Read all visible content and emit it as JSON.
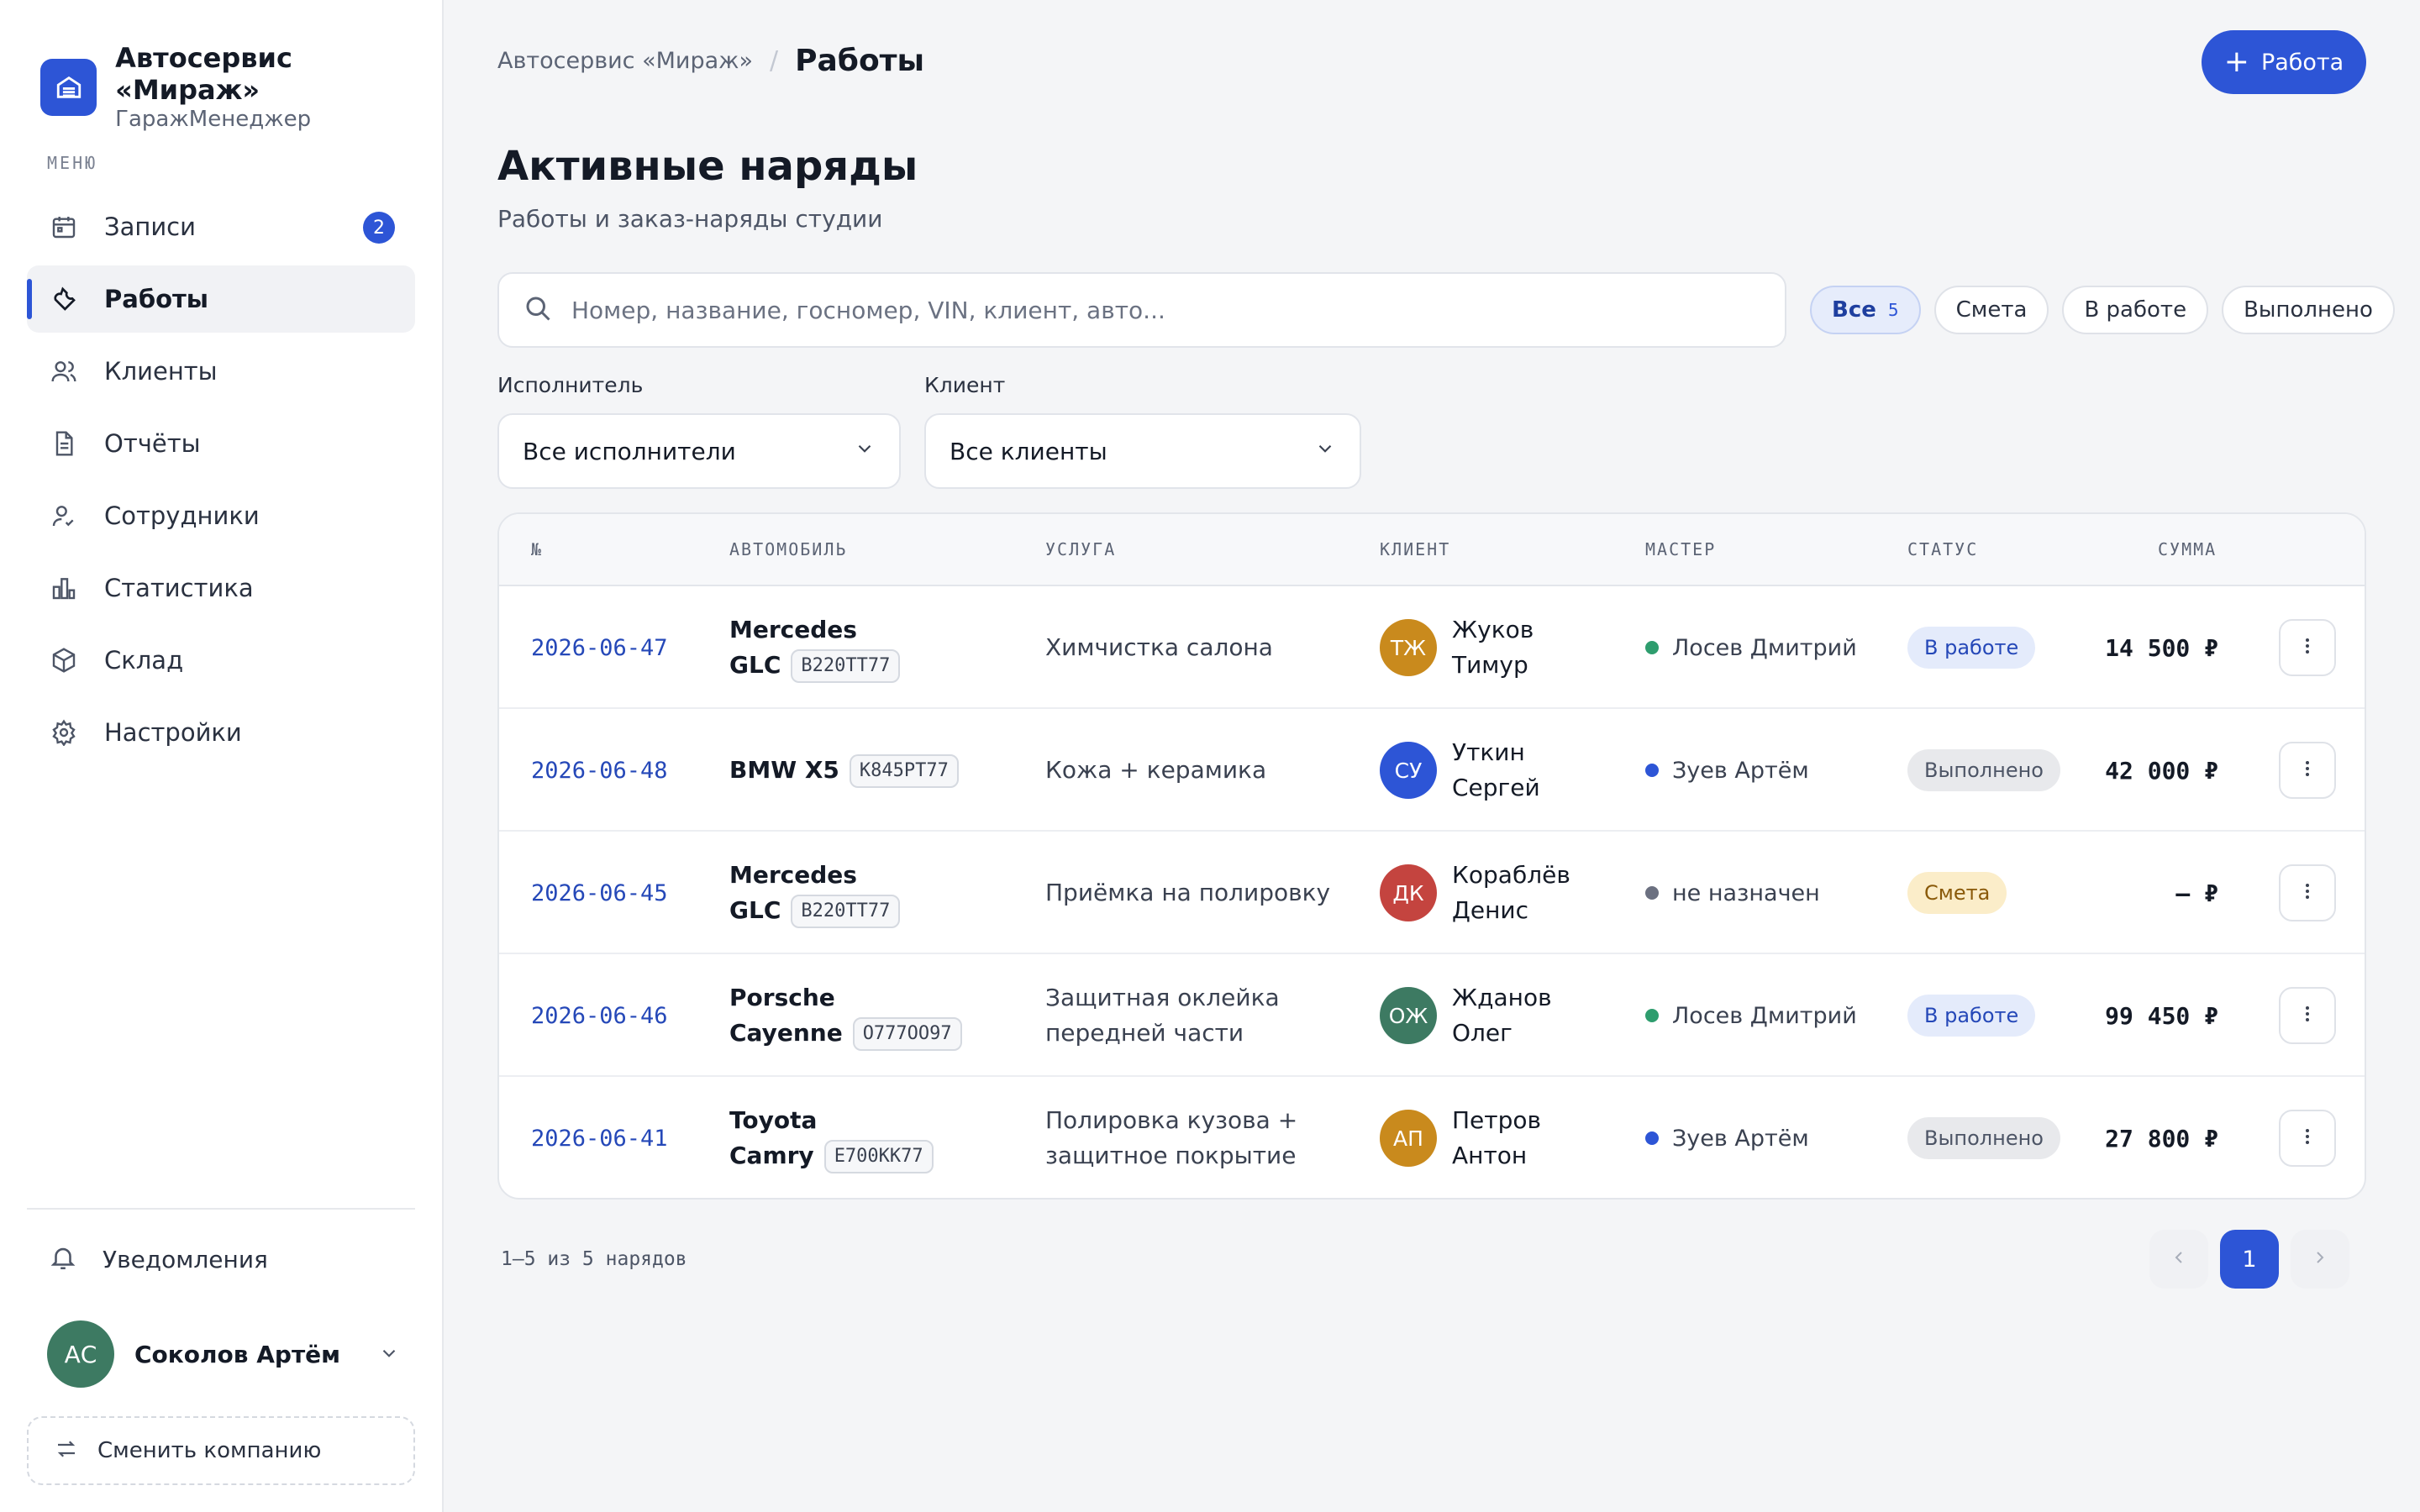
{
  "brand": {
    "name": "Автосервис «Мираж»",
    "subtitle": "ГаражМенеджер"
  },
  "sidebar": {
    "menu_label": "МЕНЮ",
    "items": [
      {
        "label": "Записи",
        "icon": "calendar-icon",
        "badge": "2"
      },
      {
        "label": "Работы",
        "icon": "wrench-icon",
        "active": true
      },
      {
        "label": "Клиенты",
        "icon": "users-icon"
      },
      {
        "label": "Отчёты",
        "icon": "document-icon"
      },
      {
        "label": "Сотрудники",
        "icon": "user-check-icon"
      },
      {
        "label": "Статистика",
        "icon": "bar-chart-icon"
      },
      {
        "label": "Склад",
        "icon": "box-icon"
      },
      {
        "label": "Настройки",
        "icon": "gear-icon"
      }
    ],
    "notifications_label": "Уведомления",
    "user": {
      "initials": "АС",
      "name": "Соколов Артём"
    },
    "switch_company_label": "Сменить компанию"
  },
  "header": {
    "breadcrumb_parent": "Автосервис «Мираж»",
    "breadcrumb_sep": "/",
    "breadcrumb_current": "Работы",
    "add_button_label": "Работа"
  },
  "page": {
    "title": "Активные наряды",
    "subtitle": "Работы и заказ-наряды студии"
  },
  "search": {
    "placeholder": "Номер, название, госномер, VIN, клиент, авто..."
  },
  "status_filters": [
    {
      "label": "Все",
      "count": "5",
      "active": true
    },
    {
      "label": "Смета"
    },
    {
      "label": "В работе"
    },
    {
      "label": "Выполнено"
    }
  ],
  "filters": {
    "executor_label": "Исполнитель",
    "executor_value": "Все исполнители",
    "client_label": "Клиент",
    "client_value": "Все клиенты"
  },
  "table": {
    "columns": [
      "№",
      "АВТОМОБИЛЬ",
      "УСЛУГА",
      "КЛИЕНТ",
      "МАСТЕР",
      "СТАТУС",
      "СУММА"
    ],
    "rows": [
      {
        "no": "2026-06-47",
        "car_line1": "Mercedes",
        "car_line2": "GLC",
        "plate": "В220ТТ77",
        "service_line1": "Химчистка салона",
        "service_line2": "",
        "client_initials": "ТЖ",
        "client_line1": "Жуков",
        "client_line2": "Тимур",
        "client_color": "#c98a1d",
        "master": "Лосев Дмитрий",
        "master_dot": "#2e9d6e",
        "status": "В работе",
        "status_kind": "work",
        "amount": "14 500 ₽"
      },
      {
        "no": "2026-06-48",
        "car_line1": "BMW X5",
        "car_line2": "",
        "plate": "К845РТ77",
        "service_line1": "Кожа + керамика",
        "service_line2": "",
        "client_initials": "СУ",
        "client_line1": "Уткин",
        "client_line2": "Сергей",
        "client_color": "#2d55d6",
        "master": "Зуев Артём",
        "master_dot": "#2d55d6",
        "status": "Выполнено",
        "status_kind": "done",
        "amount": "42 000 ₽"
      },
      {
        "no": "2026-06-45",
        "car_line1": "Mercedes",
        "car_line2": "GLC",
        "plate": "В220ТТ77",
        "service_line1": "Приёмка на полировку",
        "service_line2": "",
        "client_initials": "ДК",
        "client_line1": "Кораблёв",
        "client_line2": "Денис",
        "client_color": "#c4443f",
        "master": "не назначен",
        "master_dot": "#6b7080",
        "status": "Смета",
        "status_kind": "estimate",
        "amount": "— ₽"
      },
      {
        "no": "2026-06-46",
        "car_line1": "Porsche",
        "car_line2": "Cayenne",
        "plate": "О777ОО97",
        "service_line1": "Защитная оклейка",
        "service_line2": "передней части",
        "client_initials": "ОЖ",
        "client_line1": "Жданов",
        "client_line2": "Олег",
        "client_color": "#3d7a62",
        "master": "Лосев Дмитрий",
        "master_dot": "#2e9d6e",
        "status": "В работе",
        "status_kind": "work",
        "amount": "99 450 ₽"
      },
      {
        "no": "2026-06-41",
        "car_line1": "Toyota",
        "car_line2": "Camry",
        "plate": "Е700КК77",
        "service_line1": "Полировка кузова +",
        "service_line2": "защитное покрытие",
        "client_initials": "АП",
        "client_line1": "Петров",
        "client_line2": "Антон",
        "client_color": "#c98a1d",
        "master": "Зуев Артём",
        "master_dot": "#2d55d6",
        "status": "Выполнено",
        "status_kind": "done",
        "amount": "27 800 ₽"
      }
    ]
  },
  "status_colors": {
    "work": {
      "bg": "#e4ebfb",
      "fg": "#2548b8"
    },
    "done": {
      "bg": "#e8e9ec",
      "fg": "#4d5566"
    },
    "estimate": {
      "bg": "#fbedc9",
      "fg": "#8a5a0a"
    }
  },
  "pagination": {
    "info": "1–5 из 5 нарядов",
    "current_page": "1"
  },
  "colors": {
    "accent": "#2d55d6",
    "background": "#f4f5f7"
  }
}
